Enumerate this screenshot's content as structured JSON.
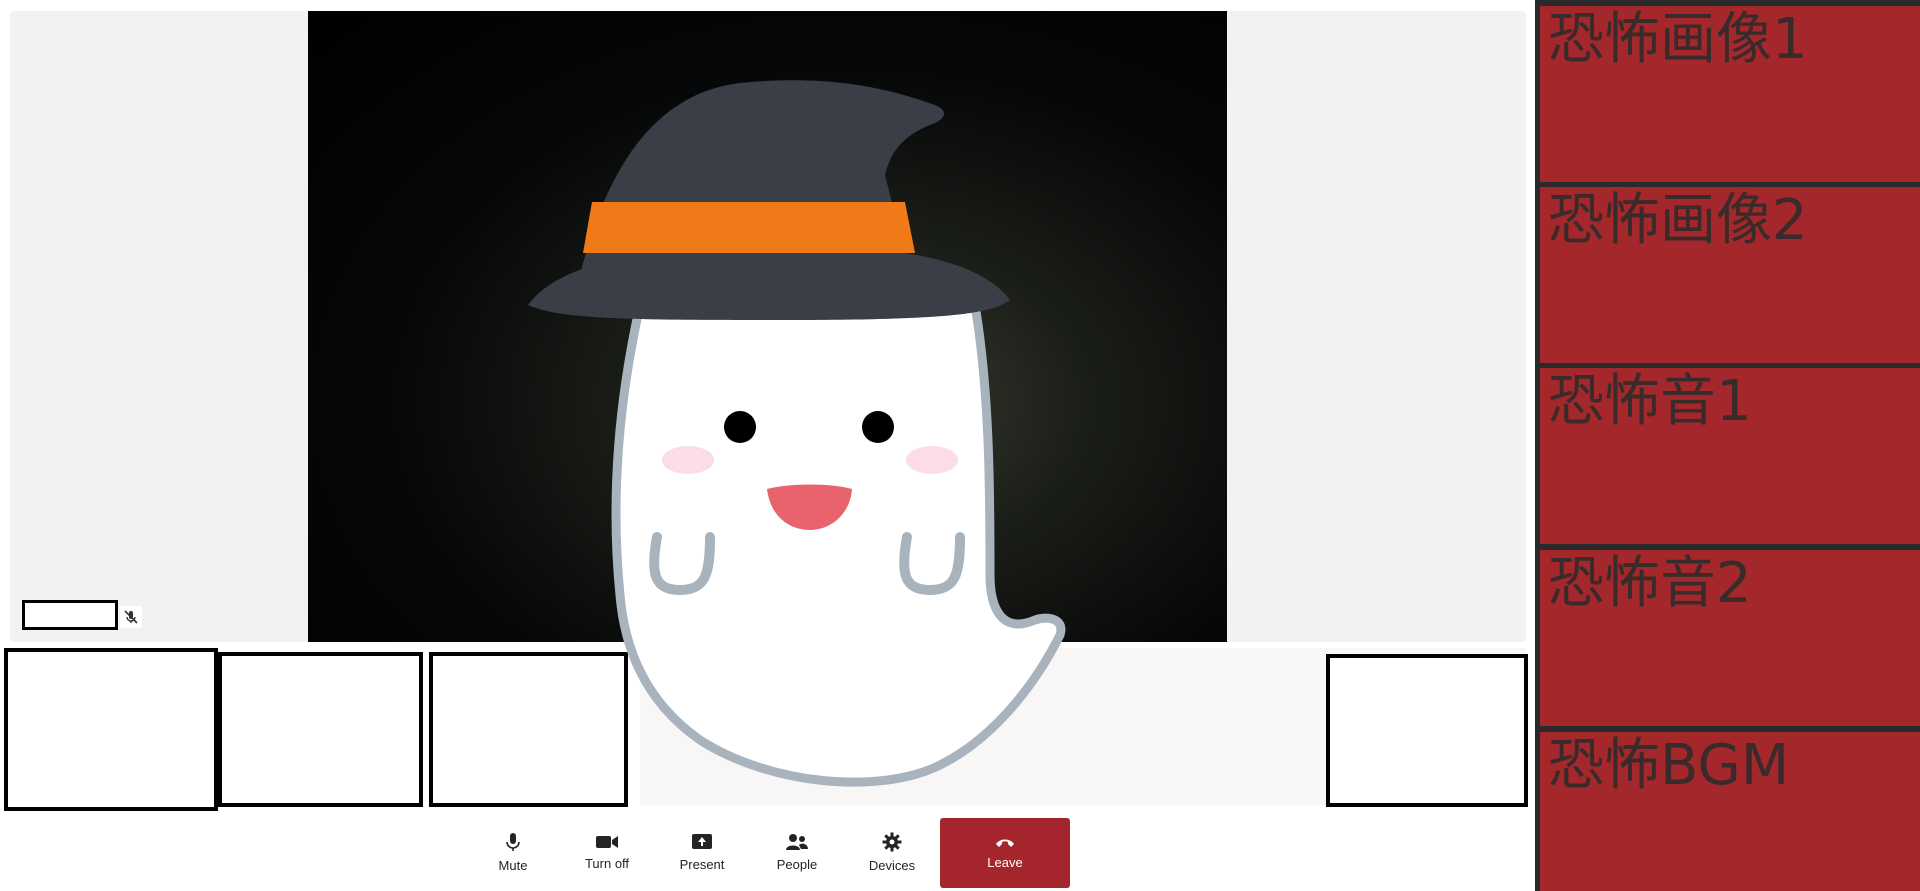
{
  "toolbar": {
    "mute": "Mute",
    "camera": "Turn off",
    "present": "Present",
    "people": "People",
    "devices": "Devices",
    "leave": "Leave"
  },
  "side_panel": {
    "items": [
      {
        "label": "恐怖画像1"
      },
      {
        "label": "恐怖画像2"
      },
      {
        "label": "恐怖音1"
      },
      {
        "label": "恐怖音2"
      },
      {
        "label": "恐怖BGM"
      }
    ]
  },
  "colors": {
    "leave": "#a4262c",
    "side_button": "#a4282b",
    "stage_bg": "#f3f2f1"
  },
  "icons": [
    "mic-icon",
    "camera-icon",
    "present-icon",
    "people-icon",
    "gear-icon",
    "hangup-icon",
    "mic-off-icon"
  ]
}
